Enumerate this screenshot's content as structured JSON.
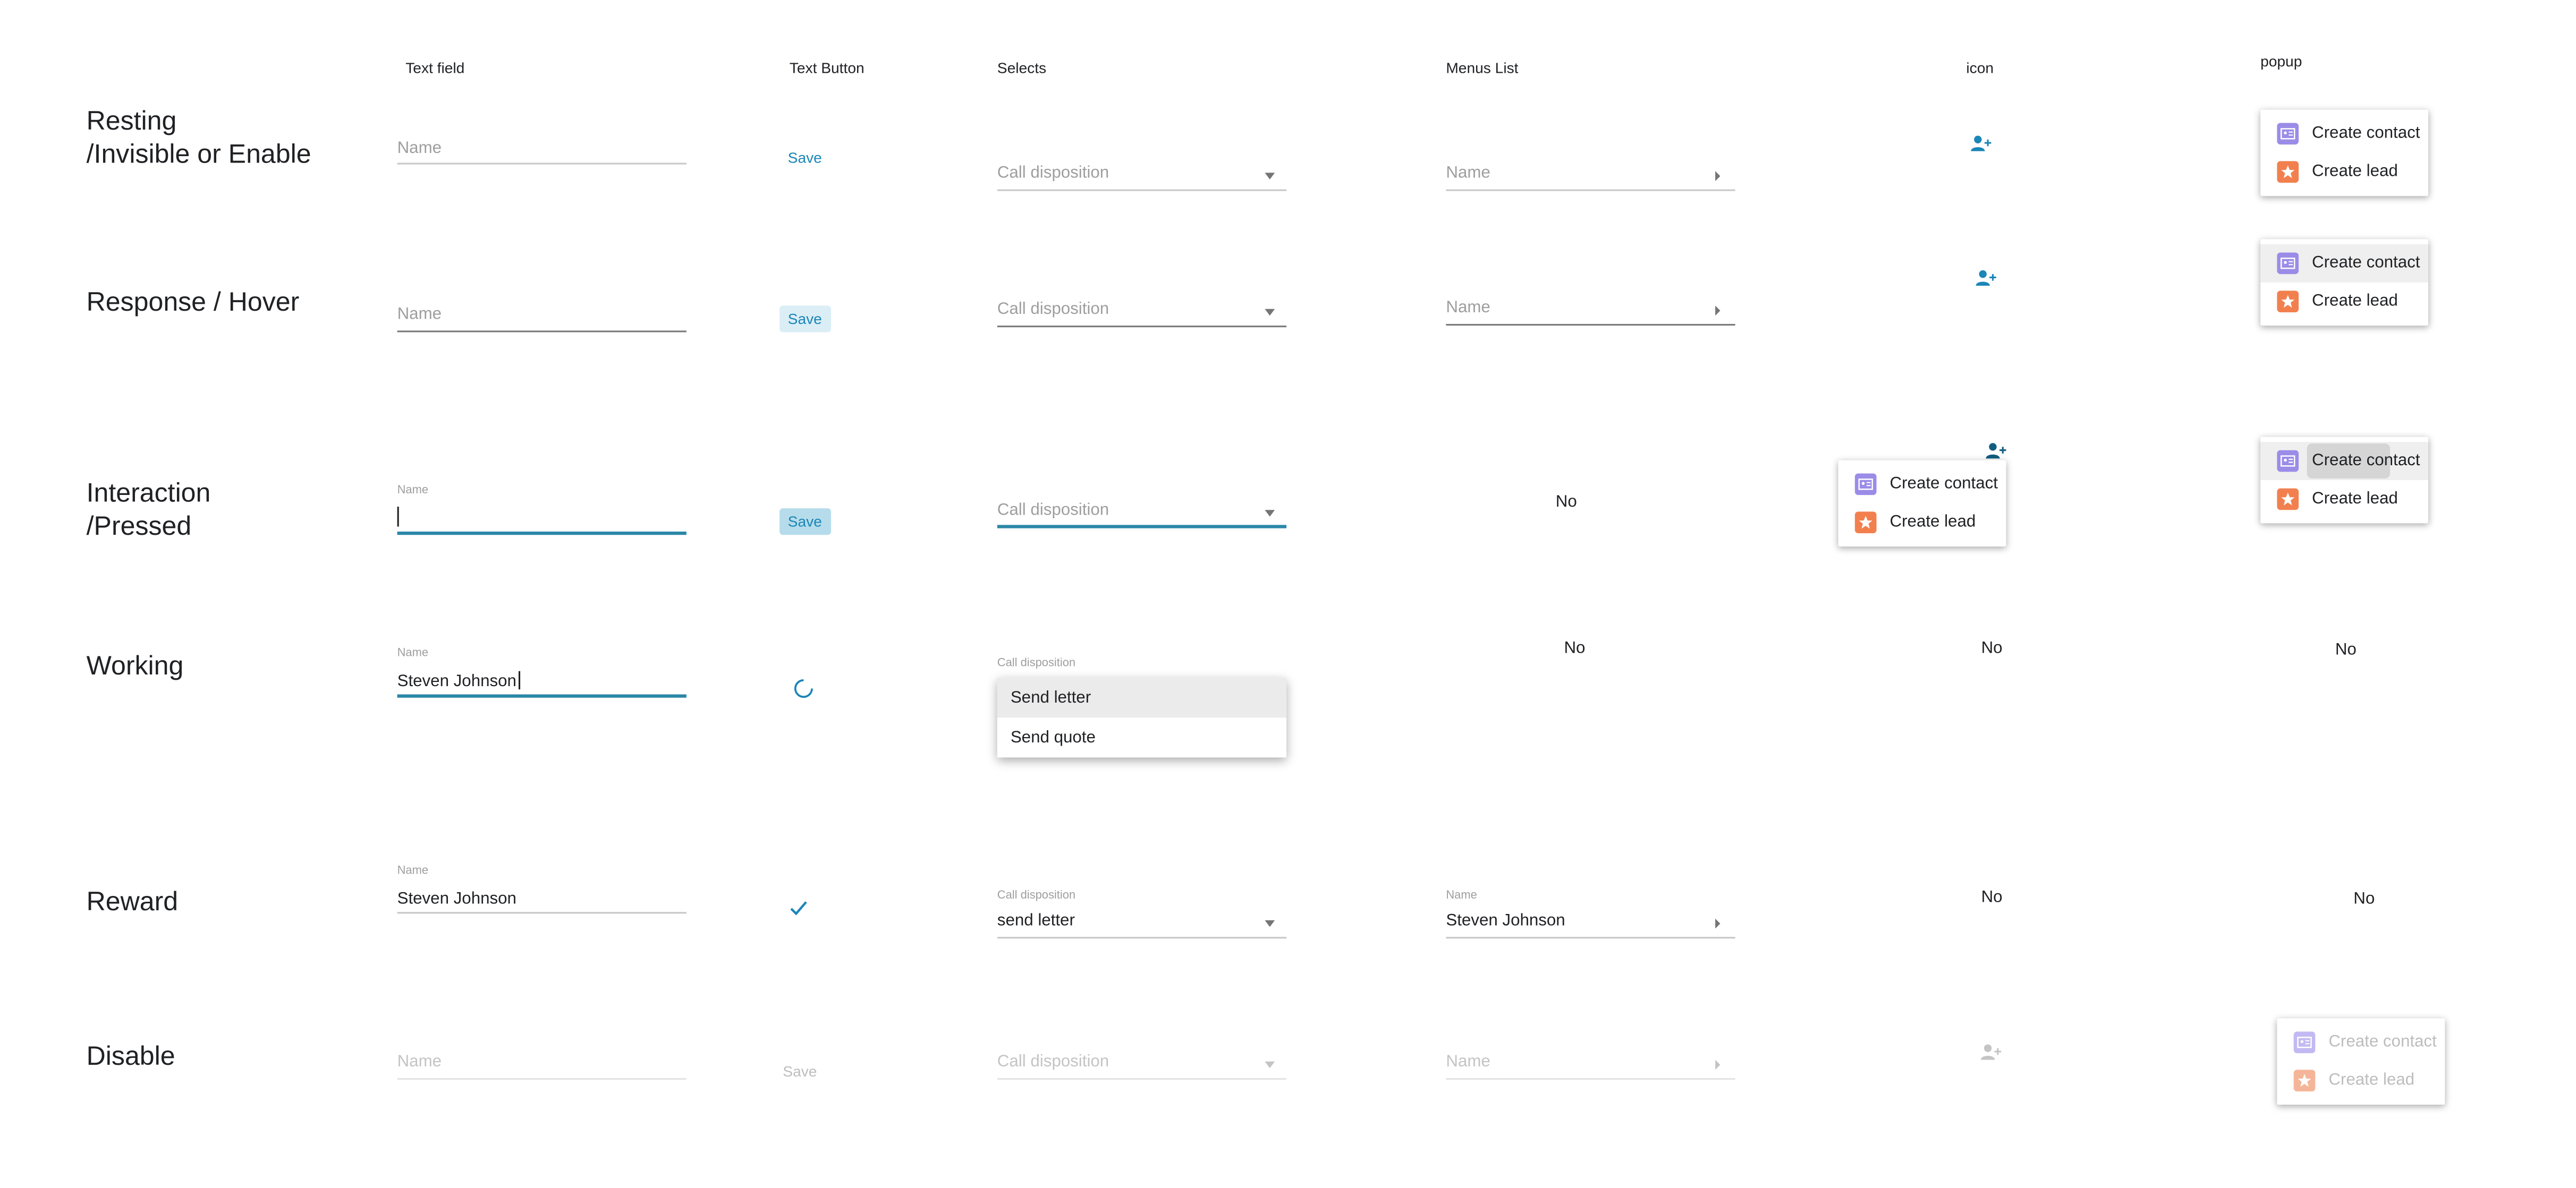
{
  "columns": {
    "text_field": "Text field",
    "text_button": "Text Button",
    "selects": "Selects",
    "menus_list": "Menus List",
    "icon": "icon",
    "popup": "popup"
  },
  "rows": {
    "resting": "Resting\n/Invisible or Enable",
    "hover": "Response / Hover",
    "pressed": "Interaction\n/Pressed",
    "working": "Working",
    "reward": "Reward",
    "disable": "Disable"
  },
  "text_field": {
    "label": "Name",
    "value": "Steven Johnson"
  },
  "text_button": {
    "label": "Save"
  },
  "select": {
    "label": "Call disposition",
    "value": "send letter",
    "options": [
      "Send letter",
      "Send quote"
    ]
  },
  "menus_list": {
    "label": "Name",
    "value": "Steven Johnson"
  },
  "popup": {
    "items": [
      {
        "label": "Create contact",
        "icon": "contact-card-icon"
      },
      {
        "label": "Create lead",
        "icon": "star-icon"
      }
    ]
  },
  "not_applicable": "No",
  "colors": {
    "accent": "#2b87a8",
    "button_text": "#1b86b7",
    "contact_icon": "#9b8ce8",
    "lead_icon": "#f2804f"
  },
  "icons": {
    "add_person": "add-person-icon",
    "checkmark": "checkmark-icon",
    "spinner": "spinner-icon"
  }
}
